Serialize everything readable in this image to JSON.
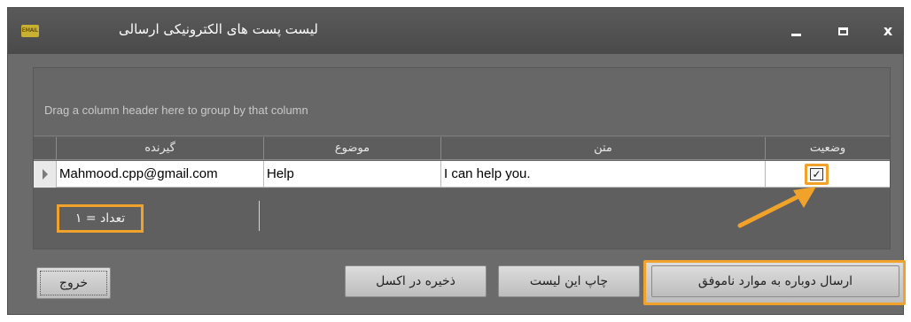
{
  "window": {
    "title": "لیست پست های الکترونیکی ارسالی",
    "icon_text": "EMAIL",
    "controls": {
      "close": "x"
    }
  },
  "grid": {
    "group_panel_text": "Drag a column header here to group by that column",
    "columns": [
      "گیرنده",
      "موضوع",
      "متن",
      "وضعیت"
    ],
    "rows": [
      {
        "recipient": "Mahmood.cpp@gmail.com",
        "subject": "Help",
        "text": "I can help you.",
        "status_checked": true
      }
    ],
    "footer_count": "تعداد = ۱"
  },
  "buttons": {
    "exit": "خروج",
    "save_excel": "ذخیره در اکسل",
    "print_list": "چاپ این لیست",
    "resend_failed": "ارسال دوباره به موارد ناموفق"
  },
  "colors": {
    "highlight": "#f0a22a",
    "window_bg": "#6b6b6b"
  },
  "icons": [
    "email-app-icon",
    "minimize-icon",
    "maximize-icon",
    "close-icon",
    "row-indicator-icon",
    "checkbox-icon",
    "pointer-arrow-icon"
  ]
}
